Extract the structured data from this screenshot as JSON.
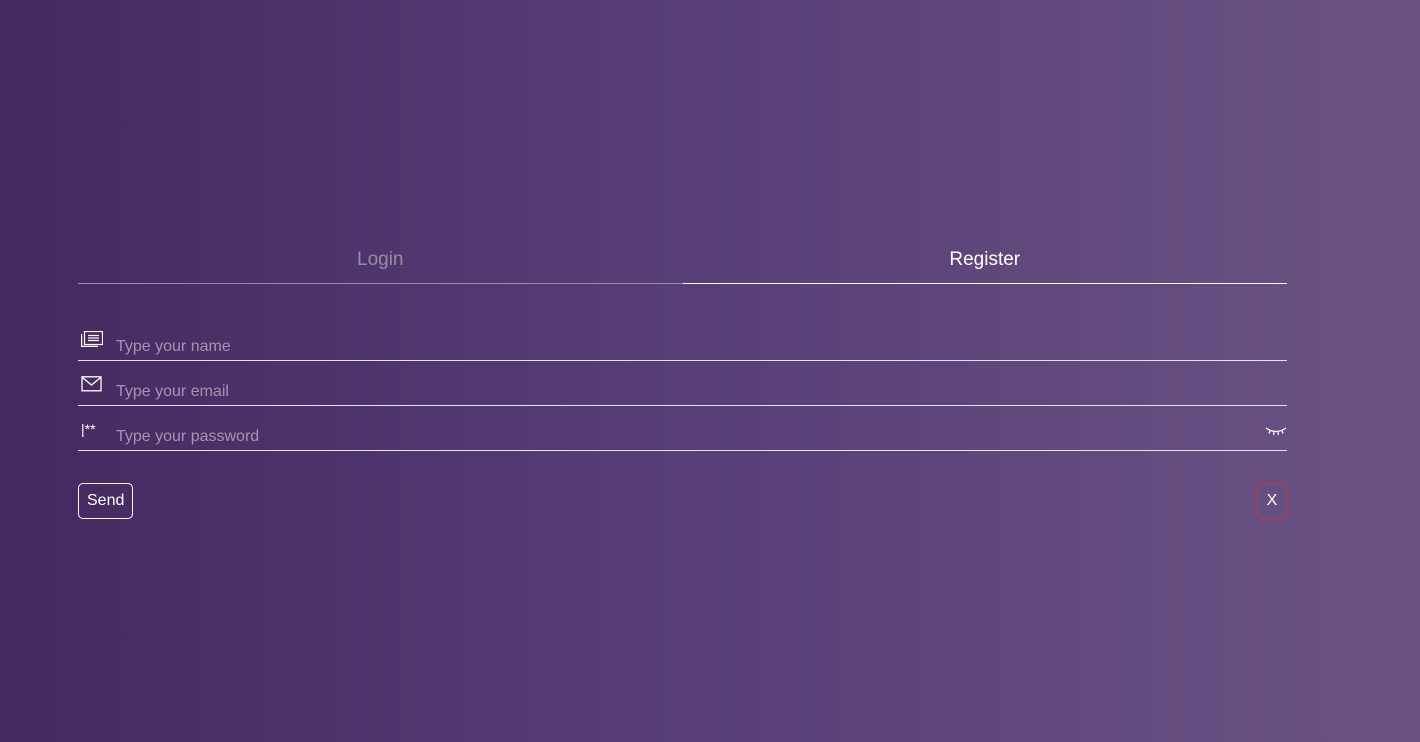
{
  "tabs": {
    "login_label": "Login",
    "register_label": "Register",
    "active": "Register"
  },
  "form": {
    "name_placeholder": "Type your name",
    "email_placeholder": "Type your email",
    "password_placeholder": "Type your password",
    "password_icon_text": "|**"
  },
  "icons": {
    "name": "id-card-icon",
    "email": "envelope-icon",
    "password": "password-asterisks-icon",
    "toggle": "eye-closed-icon"
  },
  "actions": {
    "send_label": "Send",
    "close_label": "X"
  },
  "colors": {
    "background_start": "#44295f",
    "background_end": "#6a5383",
    "close_border": "#c9363d"
  }
}
